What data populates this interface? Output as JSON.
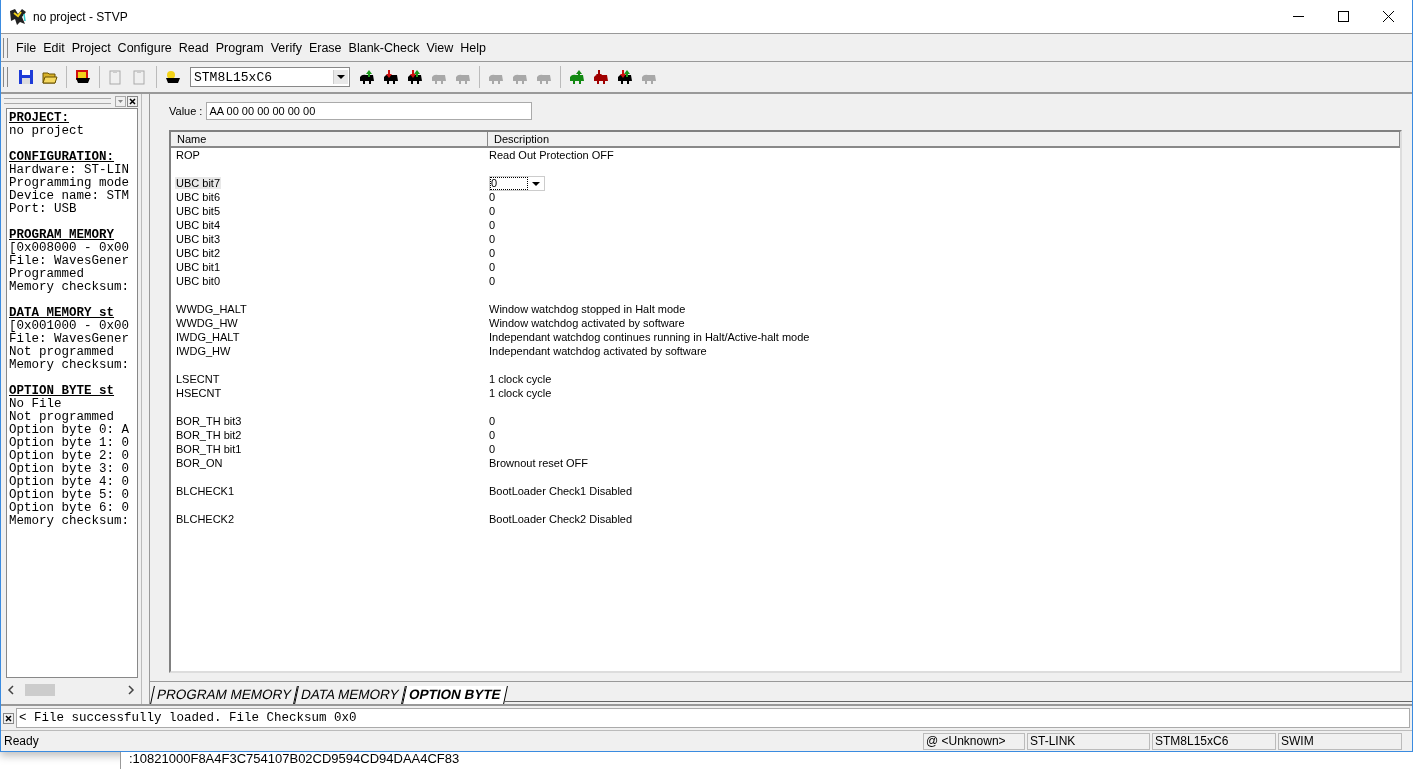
{
  "window": {
    "title": "no project - STVP"
  },
  "menu": [
    "File",
    "Edit",
    "Project",
    "Configure",
    "Read",
    "Program",
    "Verify",
    "Erase",
    "Blank-Check",
    "View",
    "Help"
  ],
  "toolbar": [
    [
      {
        "kind": "save",
        "disabled": false
      },
      {
        "kind": "open",
        "disabled": false
      }
    ],
    [
      {
        "kind": "project-chip",
        "disabled": false
      }
    ],
    [
      {
        "kind": "paste",
        "disabled": true
      },
      {
        "kind": "copy",
        "disabled": true
      }
    ],
    [
      {
        "kind": "device-chip",
        "disabled": false
      },
      {
        "kind": "device-select",
        "value": "STM8L15xC6"
      },
      {
        "kind": "chip-read",
        "disabled": false
      },
      {
        "kind": "chip-program",
        "disabled": false
      },
      {
        "kind": "chip-verify",
        "disabled": false
      },
      {
        "kind": "chip-erase",
        "disabled": true
      },
      {
        "kind": "chip-blank",
        "disabled": true
      }
    ],
    [
      {
        "kind": "chip-read",
        "disabled": true
      },
      {
        "kind": "chip-program",
        "disabled": true
      },
      {
        "kind": "chip-verify",
        "disabled": true
      }
    ],
    [
      {
        "kind": "green-chip-read",
        "disabled": false
      },
      {
        "kind": "red-chip-program",
        "disabled": false
      },
      {
        "kind": "chip-verify",
        "disabled": false
      },
      {
        "kind": "chip-erase",
        "disabled": true
      }
    ]
  ],
  "info_panel": [
    {
      "heading": "PROJECT:",
      "lines": [
        "no project"
      ]
    },
    {
      "heading": "CONFIGURATION:",
      "lines": [
        "Hardware: ST-LIN",
        "Programming mode",
        "Device name: STM",
        "Port: USB"
      ]
    },
    {
      "heading": "PROGRAM MEMORY",
      "lines": [
        "[0x008000 - 0x00",
        "File: WavesGener",
        "Programmed",
        "Memory checksum:"
      ]
    },
    {
      "heading": "DATA MEMORY st",
      "lines": [
        "[0x001000 - 0x00",
        "File: WavesGener",
        "Not programmed",
        "Memory checksum:"
      ]
    },
    {
      "heading": "OPTION BYTE st",
      "lines": [
        "No File",
        "Not programmed",
        "Option byte 0: A",
        "Option byte 1: 0",
        "Option byte 2: 0",
        "Option byte 3: 0",
        "Option byte 4: 0",
        "Option byte 5: 0",
        "Option byte 6: 0",
        "Memory checksum:"
      ]
    }
  ],
  "value_field": {
    "label": "Value :",
    "value": "AA 00 00 00 00 00 00"
  },
  "table": {
    "columns": [
      "Name",
      "Description"
    ],
    "groups": [
      [
        {
          "name": "ROP",
          "description": "Read Out Protection OFF",
          "selected": false
        }
      ],
      [
        {
          "name": "UBC bit7",
          "description": "0",
          "selected": true
        },
        {
          "name": "UBC bit6",
          "description": "0",
          "selected": false
        },
        {
          "name": "UBC bit5",
          "description": "0",
          "selected": false
        },
        {
          "name": "UBC bit4",
          "description": "0",
          "selected": false
        },
        {
          "name": "UBC bit3",
          "description": "0",
          "selected": false
        },
        {
          "name": "UBC bit2",
          "description": "0",
          "selected": false
        },
        {
          "name": "UBC bit1",
          "description": "0",
          "selected": false
        },
        {
          "name": "UBC bit0",
          "description": "0",
          "selected": false
        }
      ],
      [
        {
          "name": "WWDG_HALT",
          "description": "Window watchdog stopped in Halt mode",
          "selected": false
        },
        {
          "name": "WWDG_HW",
          "description": "Window watchdog activated by software",
          "selected": false
        },
        {
          "name": "IWDG_HALT",
          "description": "Independant watchdog continues running in Halt/Active-halt mode",
          "selected": false
        },
        {
          "name": "IWDG_HW",
          "description": "Independant watchdog activated by software",
          "selected": false
        }
      ],
      [
        {
          "name": "LSECNT",
          "description": "1 clock cycle",
          "selected": false
        },
        {
          "name": "HSECNT",
          "description": "1 clock cycle",
          "selected": false
        }
      ],
      [
        {
          "name": "BOR_TH bit3",
          "description": "0",
          "selected": false
        },
        {
          "name": "BOR_TH bit2",
          "description": "0",
          "selected": false
        },
        {
          "name": "BOR_TH bit1",
          "description": "0",
          "selected": false
        },
        {
          "name": "BOR_ON",
          "description": "Brownout reset OFF",
          "selected": false
        }
      ],
      [
        {
          "name": "BLCHECK1",
          "description": "BootLoader Check1 Disabled",
          "selected": false
        }
      ],
      [
        {
          "name": "BLCHECK2",
          "description": "BootLoader Check2 Disabled",
          "selected": false
        }
      ]
    ]
  },
  "tabs": [
    {
      "label": "PROGRAM MEMORY",
      "selected": false
    },
    {
      "label": "DATA MEMORY",
      "selected": false
    },
    {
      "label": "OPTION BYTE",
      "selected": true
    }
  ],
  "console": {
    "message": "< File successfully loaded. File Checksum 0x0"
  },
  "status_bar": {
    "message": "Ready",
    "panes": [
      "@ <Unknown>",
      "ST-LINK",
      "STM8L15xC6",
      "SWIM"
    ]
  },
  "background_window": {
    "line": ":10821000F8A4F3C754107B02CD9594CD94DAA4CF83"
  }
}
